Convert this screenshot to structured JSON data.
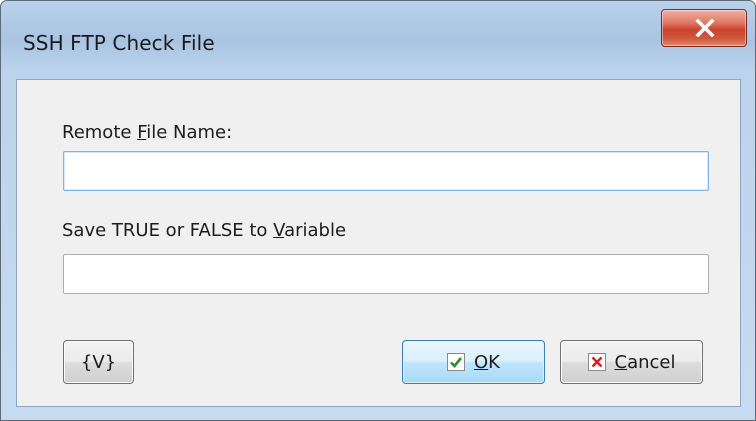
{
  "window": {
    "title": "SSH FTP Check File"
  },
  "icons": {
    "close": "close-icon",
    "ok": "checkmark-icon",
    "cancel": "cross-icon"
  },
  "form": {
    "remote_file": {
      "label_before": "Remote ",
      "label_accel": "F",
      "label_after": "ile Name:",
      "value": ""
    },
    "variable": {
      "label_before": "Save TRUE or FALSE to ",
      "label_accel": "V",
      "label_after": "ariable",
      "value": ""
    }
  },
  "buttons": {
    "variables_label": "{V}",
    "ok_accel": "O",
    "ok_rest": "K",
    "cancel_accel": "C",
    "cancel_rest": "ancel"
  },
  "colors": {
    "close_button": "#c9432c",
    "ok_check": "#2e8b2e",
    "cancel_cross": "#d02020"
  }
}
